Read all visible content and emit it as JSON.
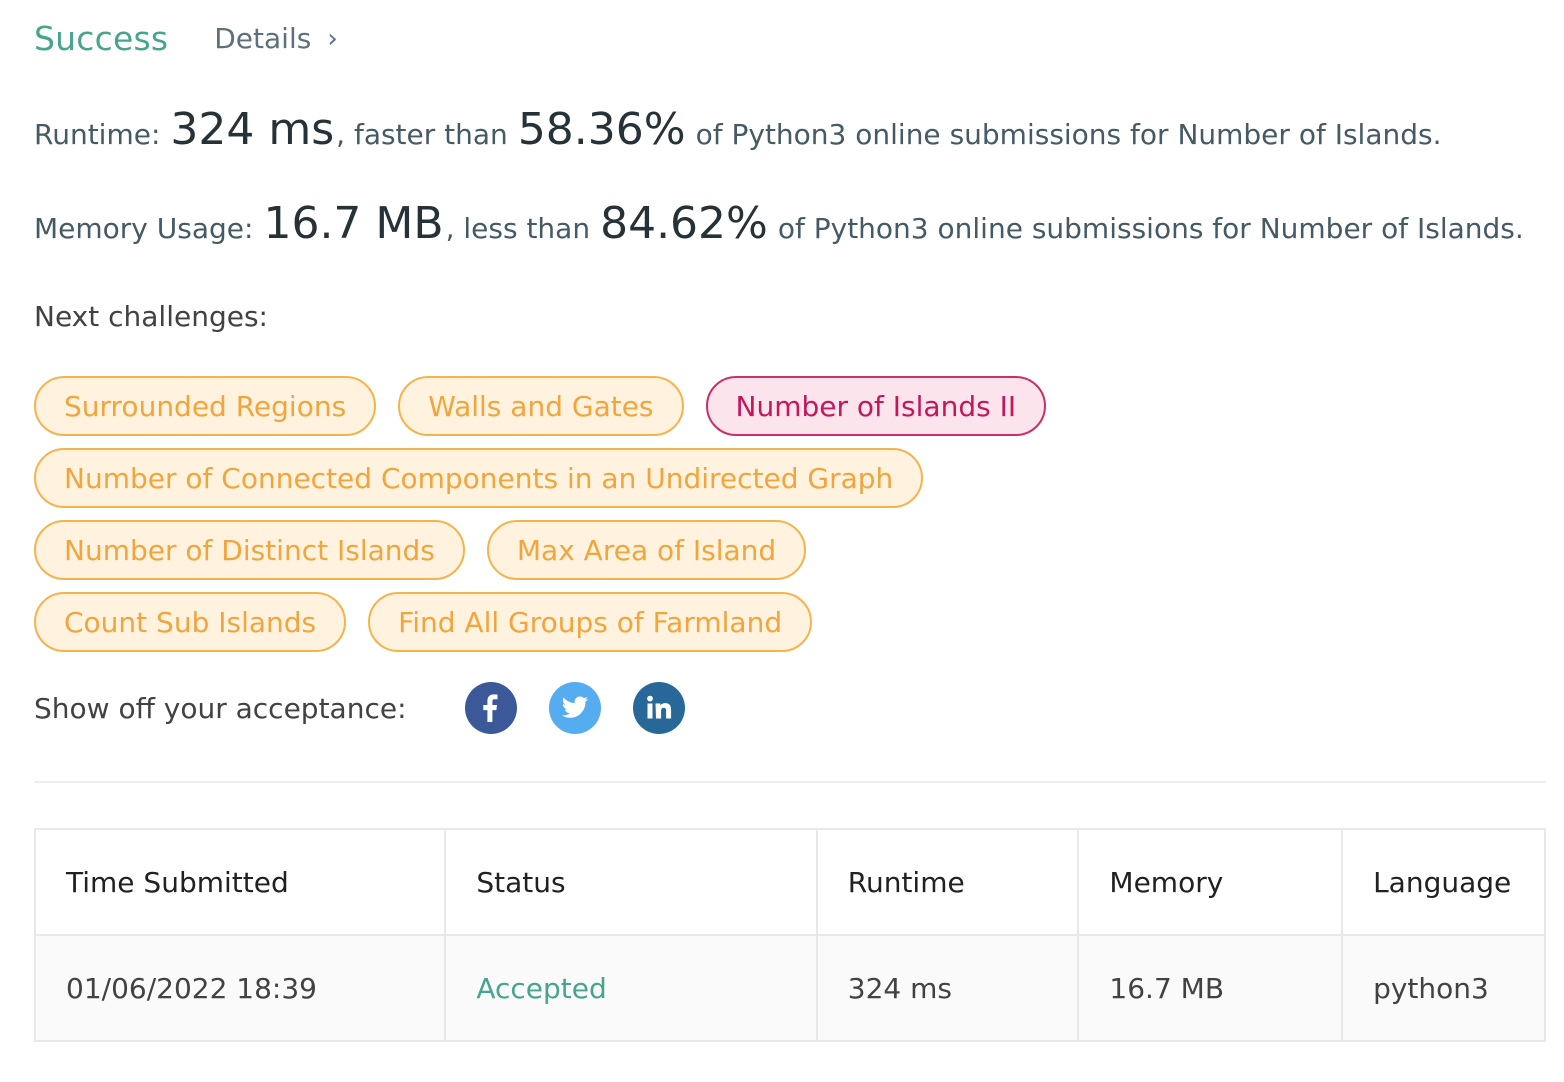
{
  "header": {
    "status": "Success",
    "details_label": "Details",
    "details_chevron": "›"
  },
  "runtime": {
    "label": "Runtime:",
    "value": "324 ms",
    "comparison": ", faster than",
    "percent": "58.36%",
    "suffix": "of Python3 online submissions for Number of Islands."
  },
  "memory": {
    "label": "Memory Usage:",
    "value": "16.7 MB",
    "comparison": ", less than",
    "percent": "84.62%",
    "suffix": "of Python3 online submissions for Number of Islands."
  },
  "next_challenges": {
    "label": "Next challenges:",
    "rows": [
      [
        {
          "label": "Surrounded Regions",
          "difficulty": "medium"
        },
        {
          "label": "Walls and Gates",
          "difficulty": "medium"
        },
        {
          "label": "Number of Islands II",
          "difficulty": "hard"
        }
      ],
      [
        {
          "label": "Number of Connected Components in an Undirected Graph",
          "difficulty": "medium"
        }
      ],
      [
        {
          "label": "Number of Distinct Islands",
          "difficulty": "medium"
        },
        {
          "label": "Max Area of Island",
          "difficulty": "medium"
        }
      ],
      [
        {
          "label": "Count Sub Islands",
          "difficulty": "medium"
        },
        {
          "label": "Find All Groups of Farmland",
          "difficulty": "medium"
        }
      ]
    ]
  },
  "share": {
    "label": "Show off your acceptance:",
    "icons": [
      "facebook-icon",
      "twitter-icon",
      "linkedin-icon"
    ]
  },
  "colors": {
    "success": "#47a48f",
    "medium_chip_border": "#f5b34c",
    "medium_chip_bg": "#fff3e0",
    "hard_chip_border": "#c7306a",
    "hard_chip_bg": "#fce4ec",
    "facebook": "#3b5998",
    "twitter": "#55acee",
    "linkedin": "#286898"
  },
  "submissions": {
    "columns": [
      "Time Submitted",
      "Status",
      "Runtime",
      "Memory",
      "Language"
    ],
    "rows": [
      [
        "01/06/2022 18:39",
        "Accepted",
        "324 ms",
        "16.7 MB",
        "python3"
      ]
    ]
  }
}
